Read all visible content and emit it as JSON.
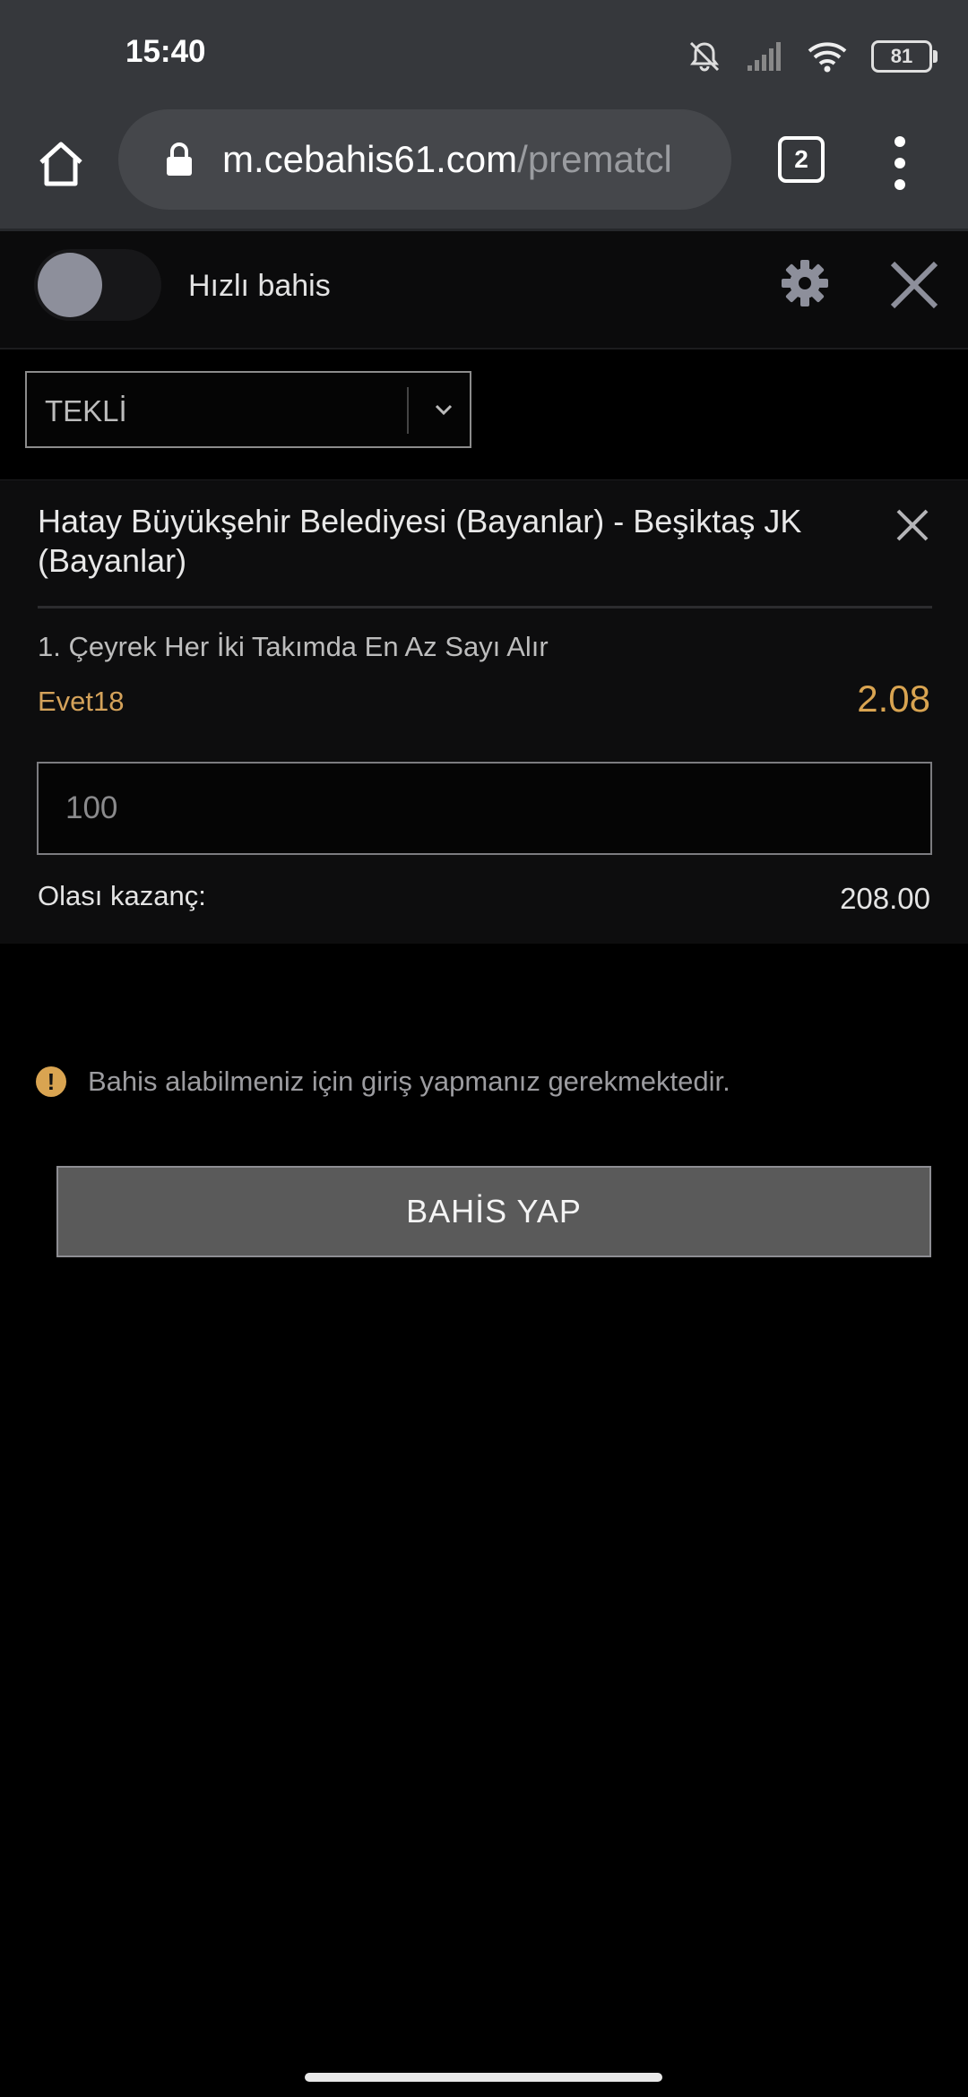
{
  "status_bar": {
    "time": "15:40",
    "battery_level": "81",
    "icons": [
      "mute-bell-icon",
      "signal-icon",
      "wifi-icon",
      "battery-icon"
    ]
  },
  "browser": {
    "url_domain": "m.cebahis61.com",
    "url_path": "/prematcl",
    "tab_count": "2",
    "icons": [
      "home-icon",
      "lock-icon",
      "tabs-icon",
      "more-menu-icon"
    ]
  },
  "slip_header": {
    "quick_bet_label": "Hızlı bahis",
    "quick_bet_enabled": false,
    "icons": [
      "gear-icon",
      "close-icon"
    ]
  },
  "bet_type": {
    "selected": "TEKLİ"
  },
  "bet": {
    "match": "Hatay Büyükşehir Belediyesi (Bayanlar) - Beşiktaş JK (Bayanlar)",
    "market": "1. Çeyrek Her İki Takımda En Az Sayı Alır",
    "selection": "Evet18",
    "odds": "2.08",
    "stake_placeholder": "100",
    "potential_win_label": "Olası kazanç:",
    "potential_win_value": "208.00"
  },
  "notice": {
    "text": "Bahis alabilmeniz için giriş yapmanız gerekmektedir.",
    "icon": "warning-icon"
  },
  "actions": {
    "place_bet_label": "BAHİS YAP"
  },
  "colors": {
    "accent_gold": "#d9a451",
    "browser_bar": "#36383c",
    "button_gray": "#5a5a5a"
  }
}
